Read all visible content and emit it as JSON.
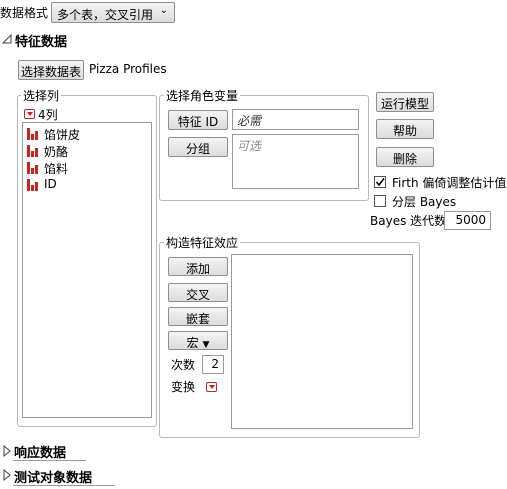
{
  "top": {
    "data_format_label": "数据格式",
    "data_format_value": "多个表，交叉引用"
  },
  "sections": {
    "feature_data": "特征数据",
    "response_data": "响应数据",
    "subject_data": "测试对象数据"
  },
  "select_table": {
    "button": "选择数据表",
    "table_name": "Pizza Profiles"
  },
  "columns_panel": {
    "title": "选择列",
    "count": "4列",
    "items": [
      "馅饼皮",
      "奶酪",
      "馅料",
      "ID"
    ]
  },
  "roles": {
    "title": "选择角色变量",
    "feature_id_button": "特征 ID",
    "feature_id_value": "必需",
    "group_button": "分组",
    "group_value": "可选"
  },
  "actions": {
    "run": "运行模型",
    "help": "帮助",
    "remove": "删除"
  },
  "options": {
    "firth_label": "Firth 偏倚调整估计值",
    "firth_checked": true,
    "hier_bayes_label": "分层 Bayes",
    "hier_bayes_checked": false,
    "bayes_iter_label": "Bayes 迭代数",
    "bayes_iter_value": "5000"
  },
  "effects": {
    "title": "构造特征效应",
    "add": "添加",
    "cross": "交叉",
    "nest": "嵌套",
    "macros": "宏",
    "degree_label": "次数",
    "degree_value": "2",
    "transform_label": "变换"
  }
}
